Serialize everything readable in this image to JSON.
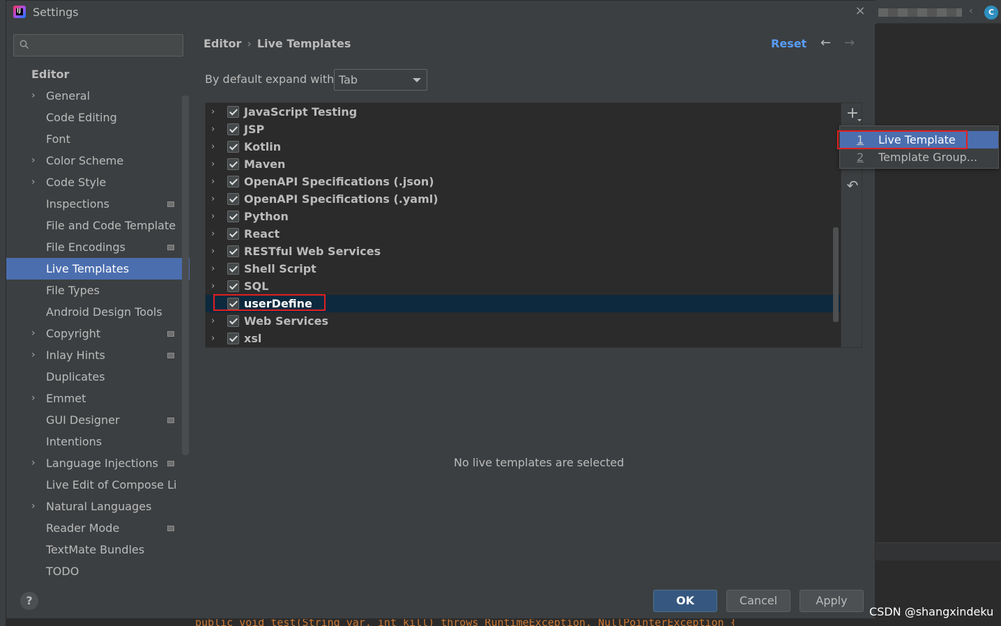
{
  "window": {
    "title": "Settings",
    "close_glyph": "×"
  },
  "search": {
    "placeholder": ""
  },
  "sidebar": {
    "header": "Editor",
    "items": [
      {
        "label": "General",
        "expandable": true,
        "project": false,
        "selected": false
      },
      {
        "label": "Code Editing",
        "expandable": false,
        "project": false,
        "selected": false
      },
      {
        "label": "Font",
        "expandable": false,
        "project": false,
        "selected": false
      },
      {
        "label": "Color Scheme",
        "expandable": true,
        "project": false,
        "selected": false
      },
      {
        "label": "Code Style",
        "expandable": true,
        "project": false,
        "selected": false
      },
      {
        "label": "Inspections",
        "expandable": false,
        "project": true,
        "selected": false
      },
      {
        "label": "File and Code Templates",
        "expandable": false,
        "project": false,
        "selected": false
      },
      {
        "label": "File Encodings",
        "expandable": false,
        "project": true,
        "selected": false
      },
      {
        "label": "Live Templates",
        "expandable": false,
        "project": false,
        "selected": true
      },
      {
        "label": "File Types",
        "expandable": false,
        "project": false,
        "selected": false
      },
      {
        "label": "Android Design Tools",
        "expandable": false,
        "project": false,
        "selected": false
      },
      {
        "label": "Copyright",
        "expandable": true,
        "project": true,
        "selected": false
      },
      {
        "label": "Inlay Hints",
        "expandable": true,
        "project": true,
        "selected": false
      },
      {
        "label": "Duplicates",
        "expandable": false,
        "project": false,
        "selected": false
      },
      {
        "label": "Emmet",
        "expandable": true,
        "project": false,
        "selected": false
      },
      {
        "label": "GUI Designer",
        "expandable": false,
        "project": true,
        "selected": false
      },
      {
        "label": "Intentions",
        "expandable": false,
        "project": false,
        "selected": false
      },
      {
        "label": "Language Injections",
        "expandable": true,
        "project": true,
        "selected": false
      },
      {
        "label": "Live Edit of Compose Literals",
        "expandable": false,
        "project": false,
        "selected": false
      },
      {
        "label": "Natural Languages",
        "expandable": true,
        "project": false,
        "selected": false
      },
      {
        "label": "Reader Mode",
        "expandable": false,
        "project": true,
        "selected": false
      },
      {
        "label": "TextMate Bundles",
        "expandable": false,
        "project": false,
        "selected": false
      },
      {
        "label": "TODO",
        "expandable": false,
        "project": false,
        "selected": false
      }
    ]
  },
  "breadcrumb": {
    "parent": "Editor",
    "separator": "›",
    "current": "Live Templates"
  },
  "header": {
    "reset_label": "Reset",
    "back_glyph": "←",
    "forward_glyph": "→"
  },
  "expand": {
    "label": "By default expand with",
    "value": "Tab"
  },
  "tree": {
    "groups": [
      {
        "label": "JavaScript Testing",
        "checked": true,
        "selected": false,
        "expandable": true
      },
      {
        "label": "JSP",
        "checked": true,
        "selected": false,
        "expandable": true
      },
      {
        "label": "Kotlin",
        "checked": true,
        "selected": false,
        "expandable": true
      },
      {
        "label": "Maven",
        "checked": true,
        "selected": false,
        "expandable": true
      },
      {
        "label": "OpenAPI Specifications (.json)",
        "checked": true,
        "selected": false,
        "expandable": true
      },
      {
        "label": "OpenAPI Specifications (.yaml)",
        "checked": true,
        "selected": false,
        "expandable": true
      },
      {
        "label": "Python",
        "checked": true,
        "selected": false,
        "expandable": true
      },
      {
        "label": "React",
        "checked": true,
        "selected": false,
        "expandable": true
      },
      {
        "label": "RESTful Web Services",
        "checked": true,
        "selected": false,
        "expandable": true
      },
      {
        "label": "Shell Script",
        "checked": true,
        "selected": false,
        "expandable": true
      },
      {
        "label": "SQL",
        "checked": true,
        "selected": false,
        "expandable": true
      },
      {
        "label": "userDefine",
        "checked": true,
        "selected": true,
        "expandable": false
      },
      {
        "label": "Web Services",
        "checked": true,
        "selected": false,
        "expandable": true
      },
      {
        "label": "xsl",
        "checked": true,
        "selected": false,
        "expandable": true
      }
    ],
    "add_glyph": "+",
    "undo_glyph": "↶"
  },
  "popup_menu": {
    "items": [
      {
        "num": "1",
        "label": "Live Template",
        "selected": true
      },
      {
        "num": "2",
        "label": "Template Group...",
        "selected": false
      }
    ]
  },
  "empty_message": "No live templates are selected",
  "footer": {
    "help_glyph": "?",
    "ok_label": "OK",
    "cancel_label": "Cancel",
    "apply_label": "Apply"
  },
  "watermark": "CSDN @shangxindeku",
  "background": {
    "code_snippet": "public void test(String var, int kill) throws RuntimeException, NullPointerException {",
    "left_arrow": "‹",
    "avatar_letter": "C"
  },
  "colors": {
    "accent": "#4b6eaf",
    "link": "#589df6",
    "highlight_box": "#e02020",
    "tree_selected": "#0d293e",
    "ok_button": "#365880"
  }
}
